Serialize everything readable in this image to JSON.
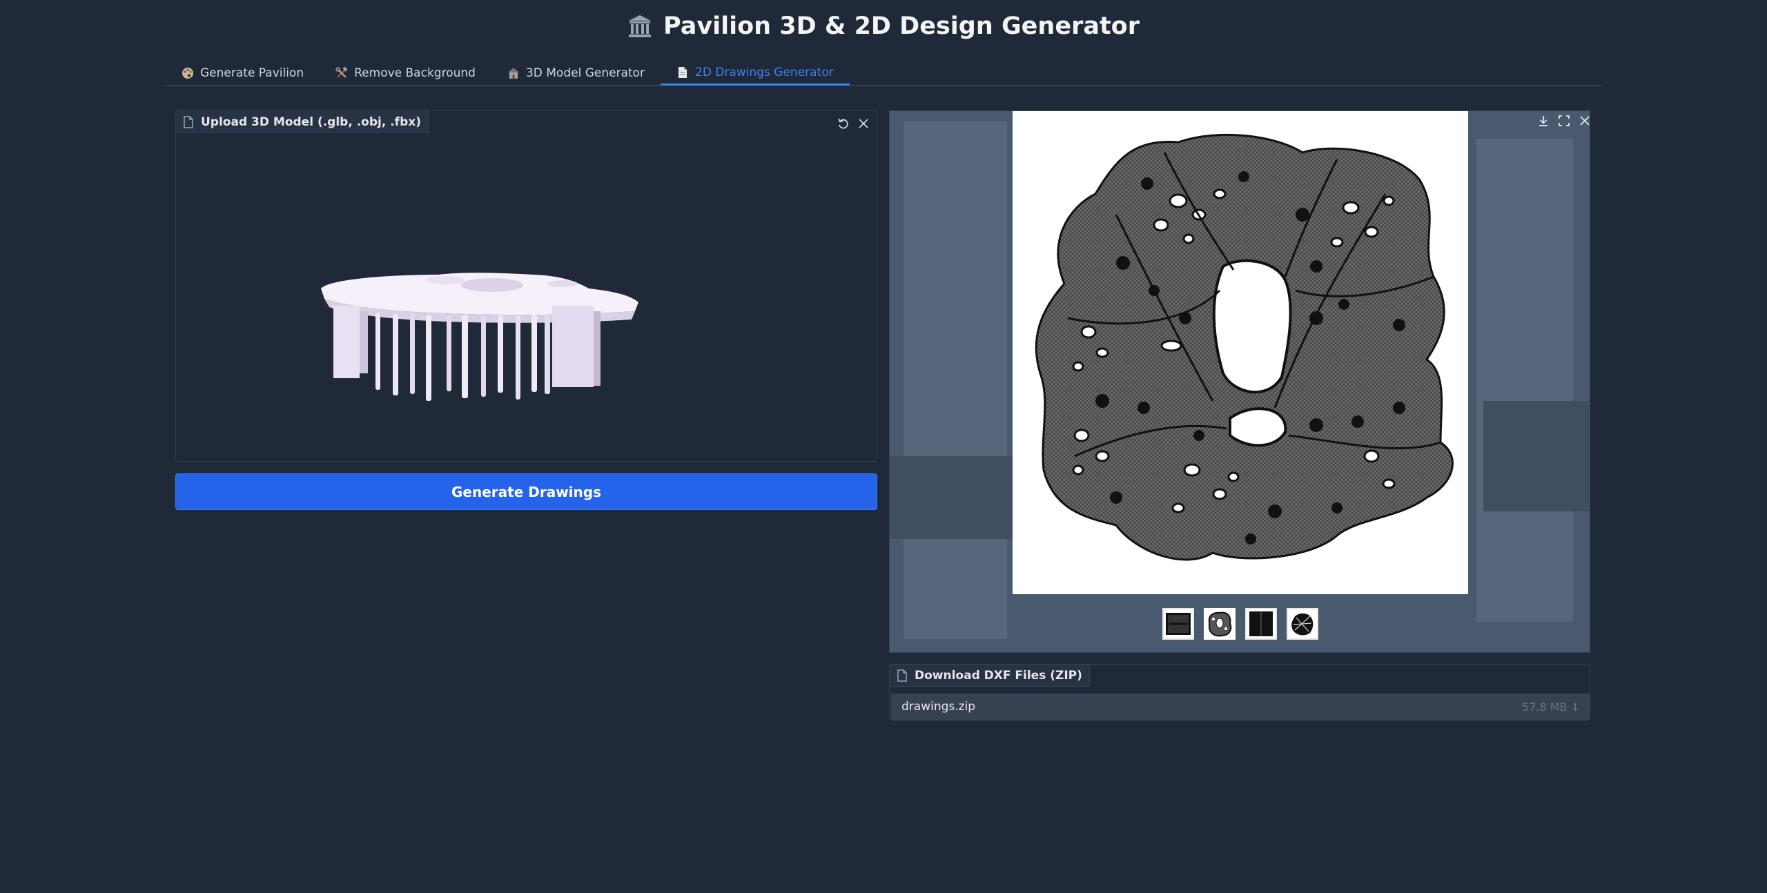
{
  "app": {
    "title": "Pavilion 3D & 2D Design Generator"
  },
  "tabs": [
    {
      "label": "Generate Pavilion",
      "icon": "palette-icon"
    },
    {
      "label": "Remove Background",
      "icon": "tools-icon"
    },
    {
      "label": "3D Model Generator",
      "icon": "house-icon"
    },
    {
      "label": "2D Drawings Generator",
      "icon": "document-icon",
      "active": true
    }
  ],
  "upload": {
    "label": "Upload 3D Model (.glb, .obj, .fbx)"
  },
  "generate_button": {
    "label": "Generate Drawings"
  },
  "gallery": {
    "thumbnail_count": 4,
    "selected_index": 1
  },
  "download": {
    "label": "Download DXF Files (ZIP)",
    "file_name": "drawings.zip",
    "file_size": "57.8 MB ↓"
  },
  "colors": {
    "background": "#1f2937",
    "accent": "#2563eb",
    "active_tab": "#3b82f6"
  }
}
